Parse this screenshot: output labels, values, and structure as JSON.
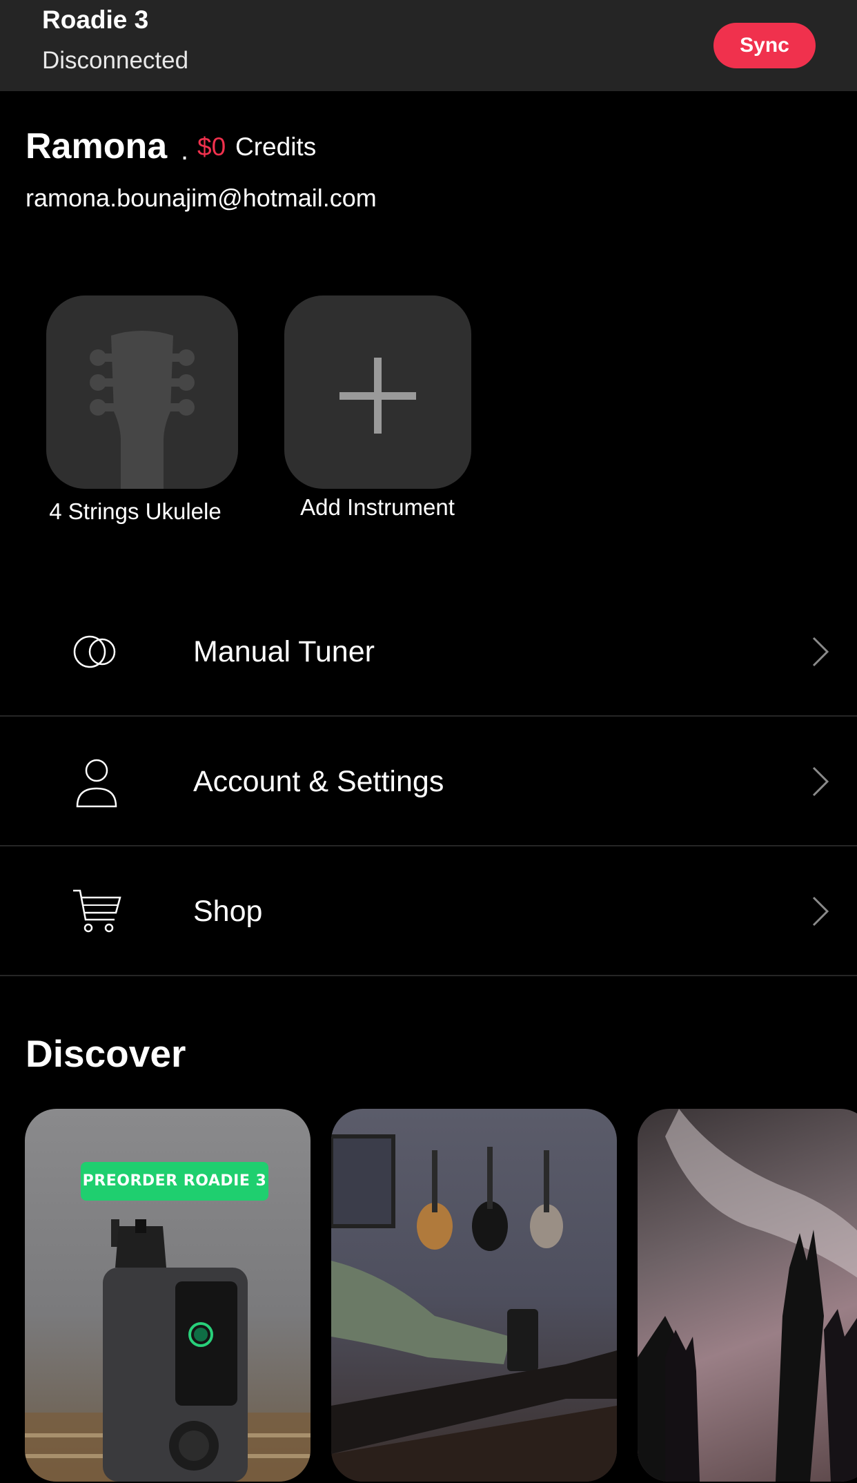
{
  "device": {
    "name": "Roadie 3",
    "status": "Disconnected",
    "sync_label": "Sync"
  },
  "profile": {
    "name": "Ramona",
    "separator": ".",
    "credits_amount": "$0",
    "credits_label": "Credits",
    "email": "ramona.bounajim@hotmail.com"
  },
  "instruments": [
    {
      "label": "4 Strings Ukulele",
      "icon": "ukulele-headstock-icon"
    },
    {
      "label": "Add Instrument",
      "icon": "plus-icon"
    }
  ],
  "menu": [
    {
      "label": "Manual Tuner",
      "icon": "tuner-circles-icon"
    },
    {
      "label": "Account & Settings",
      "icon": "person-icon"
    },
    {
      "label": "Shop",
      "icon": "cart-icon"
    }
  ],
  "discover": {
    "title": "Discover",
    "cards": [
      {
        "badge": "PREORDER ROADIE 3",
        "image": "roadie-3-device-photo"
      },
      {
        "image": "guitar-tuning-photo"
      },
      {
        "image": "concert-crowd-photo"
      }
    ]
  },
  "colors": {
    "accent": "#f0314d",
    "badge": "#1fcf6f",
    "tile": "#2f2f2f",
    "topbar": "#252525"
  }
}
